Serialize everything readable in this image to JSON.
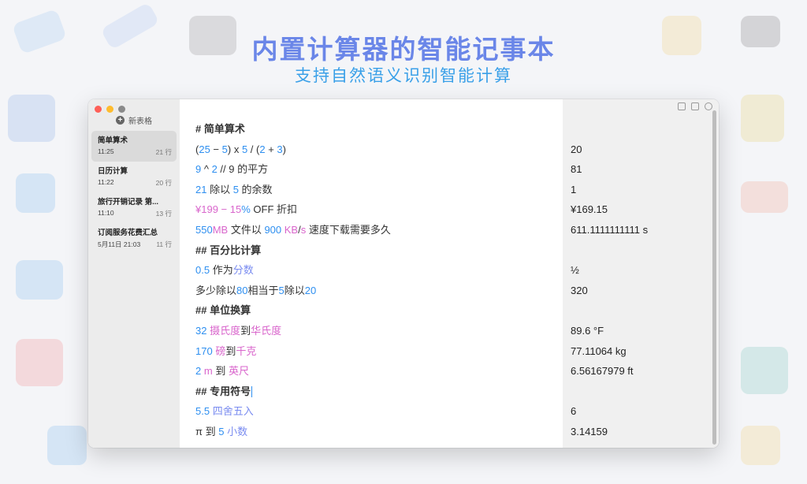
{
  "hero": {
    "title": "内置计算器的智能记事本",
    "subtitle": "支持自然语义识别智能计算"
  },
  "sidebar": {
    "new_sheet_label": "新表格",
    "items": [
      {
        "title": "简单算术",
        "time": "11:25",
        "lines": "21 行"
      },
      {
        "title": "日历计算",
        "time": "11:22",
        "lines": "20 行"
      },
      {
        "title": "旅行开销记录 第...",
        "time": "11:10",
        "lines": "13 行"
      },
      {
        "title": "订阅服务花费汇总",
        "time": "5月11日 21:03",
        "lines": "11 行"
      }
    ]
  },
  "editor": {
    "lines": [
      {
        "kind": "heading",
        "tokens": [
          {
            "t": "# 简单算术",
            "c": "heading"
          }
        ]
      },
      {
        "tokens": [
          {
            "t": "("
          },
          {
            "t": "25",
            "c": "num"
          },
          {
            "t": " − "
          },
          {
            "t": "5",
            "c": "num"
          },
          {
            "t": ") x "
          },
          {
            "t": "5",
            "c": "num"
          },
          {
            "t": " / ("
          },
          {
            "t": "2",
            "c": "num"
          },
          {
            "t": " + "
          },
          {
            "t": "3",
            "c": "num"
          },
          {
            "t": ")"
          }
        ]
      },
      {
        "tokens": [
          {
            "t": "9",
            "c": "num"
          },
          {
            "t": " ^ "
          },
          {
            "t": "2",
            "c": "num"
          },
          {
            "t": " // 9 的平方"
          }
        ]
      },
      {
        "tokens": [
          {
            "t": "21",
            "c": "num"
          },
          {
            "t": " 除以 "
          },
          {
            "t": "5",
            "c": "num"
          },
          {
            "t": " 的余数"
          }
        ]
      },
      {
        "tokens": [
          {
            "t": "¥199",
            "c": "unit"
          },
          {
            "t": " − ",
            "c": "unit"
          },
          {
            "t": "15",
            "c": "unit"
          },
          {
            "t": "%",
            "c": "num"
          },
          {
            "t": " OFF 折扣"
          }
        ]
      },
      {
        "tokens": [
          {
            "t": "550",
            "c": "num"
          },
          {
            "t": "MB",
            "c": "unit"
          },
          {
            "t": " 文件以 "
          },
          {
            "t": "900",
            "c": "num"
          },
          {
            "t": " KB",
            "c": "unit"
          },
          {
            "t": "/"
          },
          {
            "t": "s",
            "c": "unit"
          },
          {
            "t": " 速度下载需要多久"
          }
        ]
      },
      {
        "kind": "heading",
        "tokens": [
          {
            "t": "## 百分比计算",
            "c": "heading"
          }
        ]
      },
      {
        "tokens": [
          {
            "t": "0.5",
            "c": "num"
          },
          {
            "t": " 作为"
          },
          {
            "t": "分数",
            "c": "kw"
          }
        ]
      },
      {
        "tokens": [
          {
            "t": "多少除以"
          },
          {
            "t": "80",
            "c": "num"
          },
          {
            "t": "相当于"
          },
          {
            "t": "5",
            "c": "num"
          },
          {
            "t": "除以"
          },
          {
            "t": "20",
            "c": "num"
          }
        ]
      },
      {
        "kind": "heading",
        "tokens": [
          {
            "t": "## 单位换算",
            "c": "heading"
          }
        ]
      },
      {
        "tokens": [
          {
            "t": "32",
            "c": "num"
          },
          {
            "t": " "
          },
          {
            "t": "摄氏度",
            "c": "unit"
          },
          {
            "t": "到"
          },
          {
            "t": "华氏度",
            "c": "unit"
          }
        ]
      },
      {
        "tokens": [
          {
            "t": "170",
            "c": "num"
          },
          {
            "t": " "
          },
          {
            "t": "磅",
            "c": "unit"
          },
          {
            "t": "到"
          },
          {
            "t": "千克",
            "c": "unit"
          }
        ]
      },
      {
        "tokens": [
          {
            "t": "2",
            "c": "num"
          },
          {
            "t": " "
          },
          {
            "t": "m",
            "c": "unit"
          },
          {
            "t": " 到 "
          },
          {
            "t": "英尺",
            "c": "unit"
          }
        ]
      },
      {
        "kind": "heading",
        "cursor": true,
        "tokens": [
          {
            "t": "## 专用符号",
            "c": "heading"
          }
        ]
      },
      {
        "tokens": [
          {
            "t": "5.5",
            "c": "num"
          },
          {
            "t": " "
          },
          {
            "t": "四舍五入",
            "c": "kw"
          }
        ]
      },
      {
        "tokens": [
          {
            "t": "π 到 "
          },
          {
            "t": "5",
            "c": "num"
          },
          {
            "t": " "
          },
          {
            "t": "小数",
            "c": "kw"
          }
        ]
      }
    ]
  },
  "results": [
    "",
    "20",
    "81",
    "1",
    "¥169.15",
    "611.1111111111 s",
    "",
    "½",
    "320",
    "",
    "89.6 °F",
    "77.11064 kg",
    "6.56167979 ft",
    "",
    "6",
    "3.14159"
  ],
  "colors": {
    "number": "#2e8ff0",
    "unit": "#d966cc",
    "keyword": "#7a8cf0",
    "title": "#6a86e8",
    "subtitle": "#3aa0e8"
  }
}
